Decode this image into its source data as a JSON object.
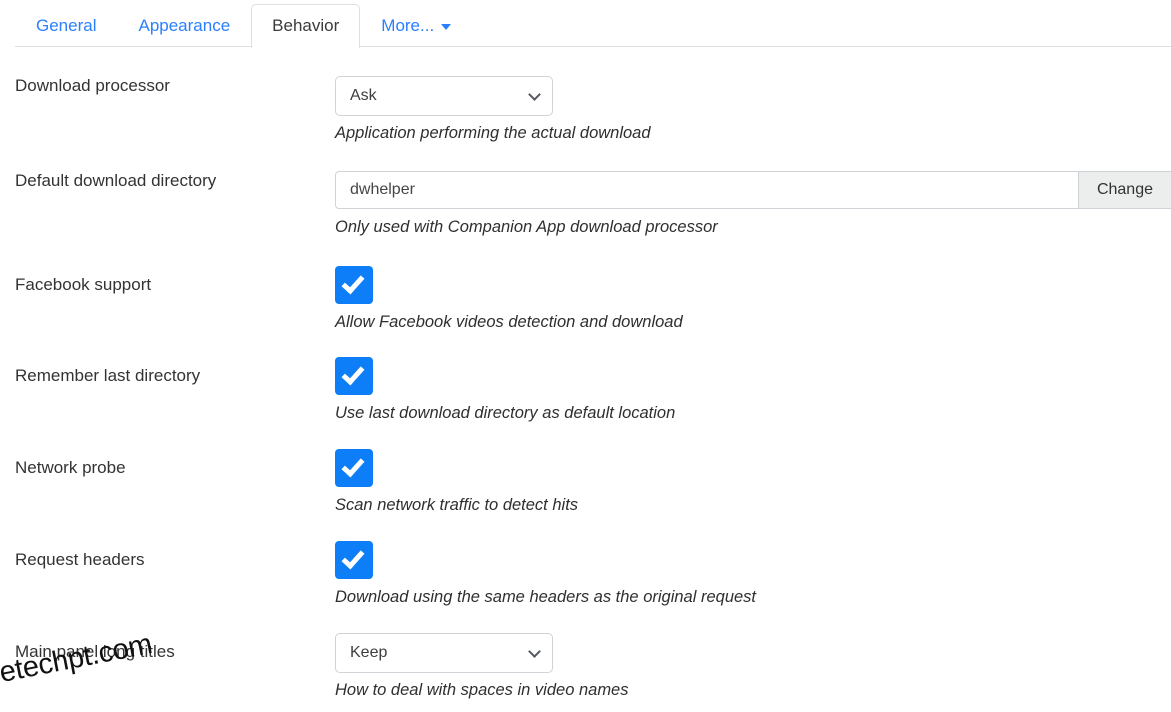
{
  "tabs": [
    {
      "label": "General",
      "active": false
    },
    {
      "label": "Appearance",
      "active": false
    },
    {
      "label": "Behavior",
      "active": true
    },
    {
      "label": "More...",
      "active": false
    }
  ],
  "rows": [
    {
      "label": "Download processor",
      "control": "select",
      "value": "Ask",
      "hint": "Application performing the actual download"
    },
    {
      "label": "Default download directory",
      "control": "input-button",
      "value": "dwhelper",
      "placeholder": "",
      "button_label": "Change",
      "hint": "Only used with Companion App download processor"
    },
    {
      "label": "Facebook support",
      "control": "checkbox",
      "checked": true,
      "hint": "Allow Facebook videos detection and download"
    },
    {
      "label": "Remember last directory",
      "control": "checkbox",
      "checked": true,
      "hint": "Use last download directory as default location"
    },
    {
      "label": "Network probe",
      "control": "checkbox",
      "checked": true,
      "hint": "Scan network traffic to detect hits"
    },
    {
      "label": "Request headers",
      "control": "checkbox",
      "checked": true,
      "hint": "Download using the same headers as the original request"
    },
    {
      "label": "Main panel long titles",
      "control": "select",
      "value": "Keep",
      "hint": "How to deal with spaces in video names"
    }
  ],
  "watermark": {
    "text": "etechpt.com"
  },
  "colors": {
    "tab_link": "#2a7fff",
    "tab_active_text": "#3b3b3b",
    "checkbox_blue": "#0d7ef7",
    "border": "#cfd2d6",
    "button_bg": "#eceded"
  },
  "icons": {
    "caret": "chevron-down-icon",
    "select_chevron": "chevron-down-icon",
    "check": "check-icon"
  }
}
